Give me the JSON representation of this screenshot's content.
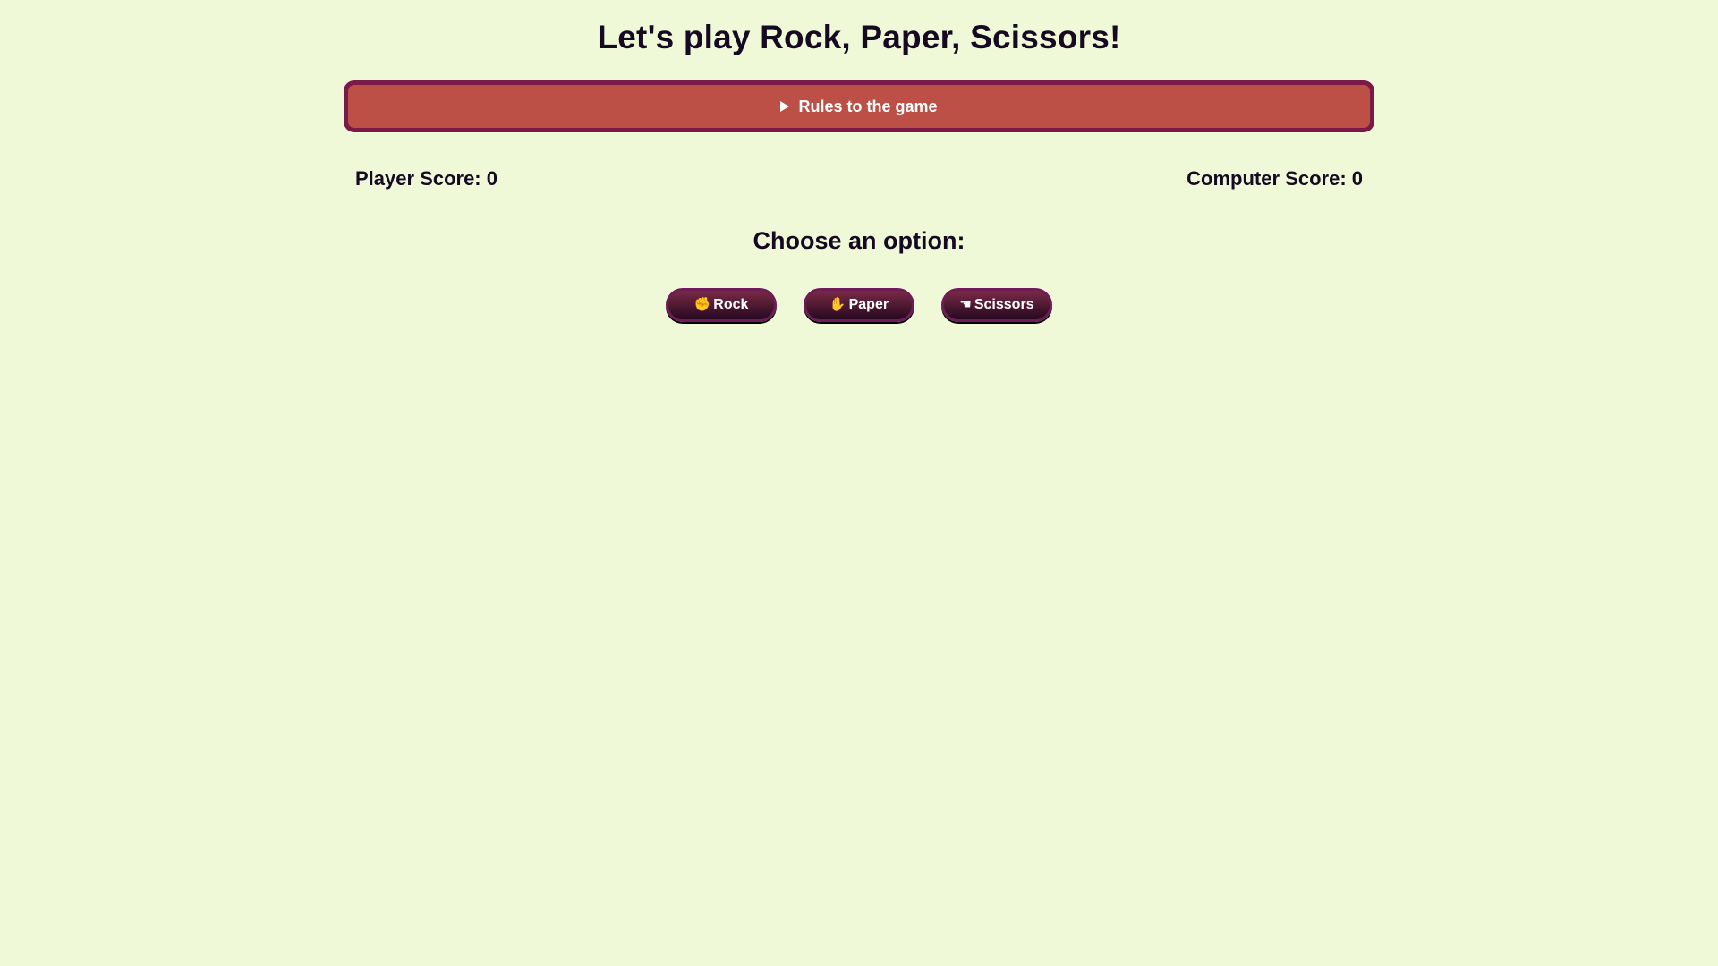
{
  "header": {
    "title": "Let's play Rock, Paper, Scissors!"
  },
  "rules": {
    "label": "Rules to the game",
    "expanded": false,
    "icon": "disclosure-triangle-icon"
  },
  "scores": {
    "player_label": "Player Score: 0",
    "computer_label": "Computer Score: 0"
  },
  "prompt": {
    "text": "Choose an option:"
  },
  "options": [
    {
      "label": "Rock",
      "icon": "raised-fist-icon",
      "glyph": "✊"
    },
    {
      "label": "Paper",
      "icon": "raised-hand-icon",
      "glyph": "✋"
    },
    {
      "label": "Scissors",
      "icon": "pointing-hand-icon",
      "glyph": "☚"
    }
  ],
  "colors": {
    "background": "#f0f9d7",
    "rules_fill": "#bc5046",
    "rules_border": "#7a1a48",
    "button_fill": "#3d1230",
    "text": "#150a22"
  }
}
